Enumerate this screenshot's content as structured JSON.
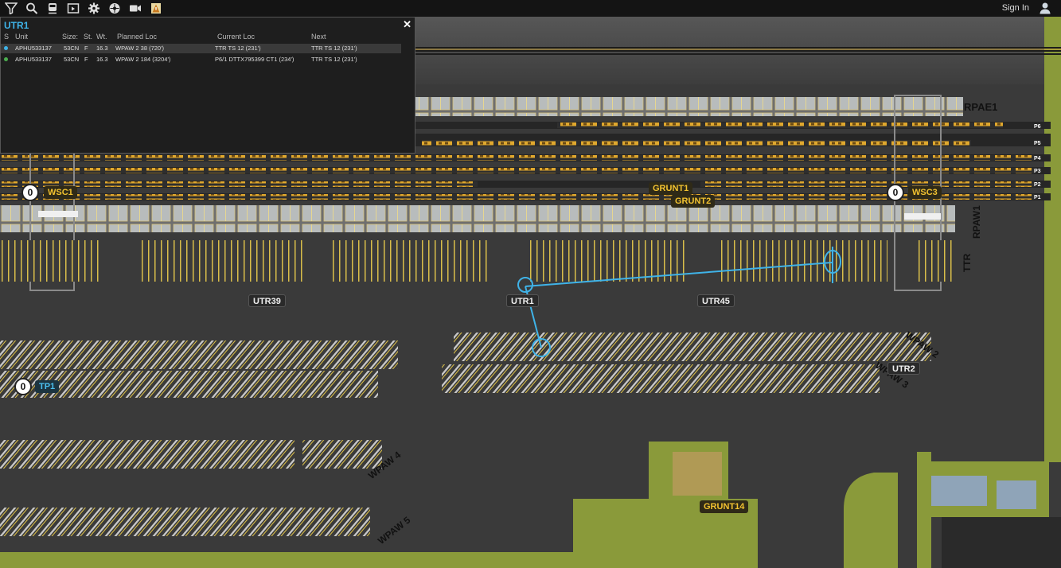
{
  "toolbar": {
    "icons": [
      "filter-icon",
      "search-icon",
      "train-icon",
      "calendar-icon",
      "gear-icon",
      "wheel-icon",
      "camera-icon",
      "alert-icon"
    ],
    "sign_in": "Sign In"
  },
  "popup": {
    "title": "UTR1",
    "columns": [
      "S",
      "Unit",
      "Size:",
      "St.",
      "Wt.",
      "Planned Loc",
      "Current Loc",
      "Next"
    ],
    "rows": [
      {
        "status_color": "#3fb3e8",
        "unit": "APHU533137",
        "size": "53CN",
        "st": "F",
        "wt": "16.3",
        "planned": "WPAW 2 38 (720')",
        "current": "TTR TS 12 (231')",
        "next": "TTR TS 12 (231')"
      },
      {
        "status_color": "#4caf50",
        "unit": "APHU533137",
        "size": "53CN",
        "st": "F",
        "wt": "16.3",
        "planned": "WPAW 2 184 (3204')",
        "current": "P6/1 DTTX795399 CT1 (234')",
        "next": "TTR TS 12 (231')"
      }
    ]
  },
  "map": {
    "labels": {
      "wsc1": "WSC1",
      "wsc3": "WSC3",
      "grunt1": "GRUNT1",
      "grunt2": "GRUNT2",
      "utr39": "UTR39",
      "utr1": "UTR1",
      "utr45": "UTR45",
      "utr2": "UTR2",
      "tp1": "TP1",
      "grunt14": "GRUNT14"
    },
    "counts": {
      "wsc1": "0",
      "wsc3": "0",
      "tp1": "0"
    },
    "areas": {
      "rpae1": "RPAE1",
      "rpaw1": "RPAW1",
      "ttr": "TTR",
      "wpaw2": "WPAW 2",
      "wpaw3": "WPAW 3",
      "wpaw4": "WPAW 4",
      "wpaw5": "WPAW 5"
    },
    "tracks": {
      "p6": "P6",
      "p5": "P5",
      "p4": "P4",
      "p3": "P3",
      "p2": "P2",
      "p1": "P1"
    }
  },
  "colors": {
    "accent": "#3fb3e8",
    "gold": "#f2c230",
    "grass": "#8a9a3a",
    "asphalt": "#3a3a3a"
  }
}
